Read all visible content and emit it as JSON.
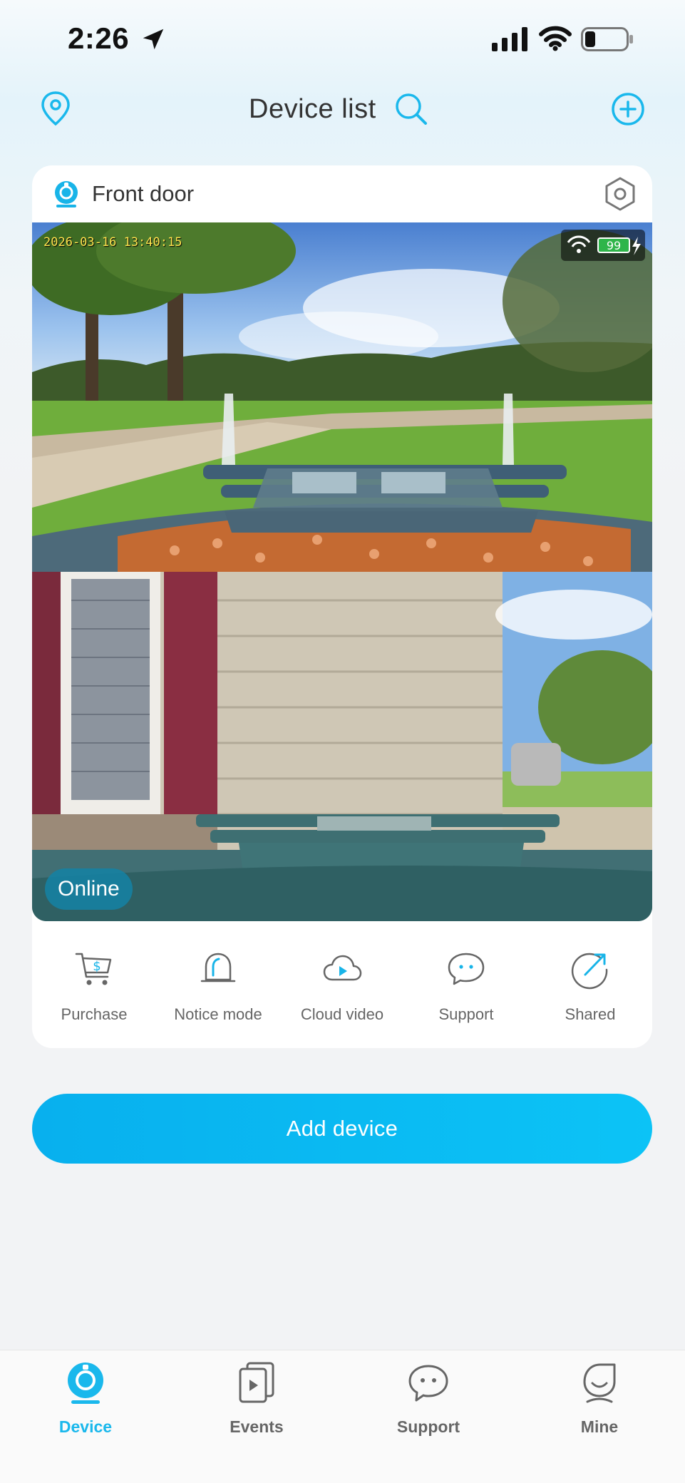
{
  "status_bar": {
    "time": "2:26"
  },
  "header": {
    "title": "Device list"
  },
  "device": {
    "name": "Front door",
    "timestamp": "2026-03-16 13:40:15",
    "battery_level": "99",
    "status": "Online"
  },
  "actions": [
    {
      "label": "Purchase",
      "icon": "cart-dollar-icon"
    },
    {
      "label": "Notice mode",
      "icon": "bell-icon"
    },
    {
      "label": "Cloud video",
      "icon": "cloud-play-icon"
    },
    {
      "label": "Support",
      "icon": "chat-bubble-icon"
    },
    {
      "label": "Shared",
      "icon": "share-arrow-icon"
    }
  ],
  "add_device_label": "Add device",
  "tabs": [
    {
      "label": "Device",
      "icon": "camera-icon",
      "active": true
    },
    {
      "label": "Events",
      "icon": "events-icon",
      "active": false
    },
    {
      "label": "Support",
      "icon": "chat-icon",
      "active": false
    },
    {
      "label": "Mine",
      "icon": "profile-icon",
      "active": false
    }
  ],
  "colors": {
    "accent": "#1ab8ec",
    "button": "#08b0ee",
    "icon_blue": "#18b4e8"
  }
}
